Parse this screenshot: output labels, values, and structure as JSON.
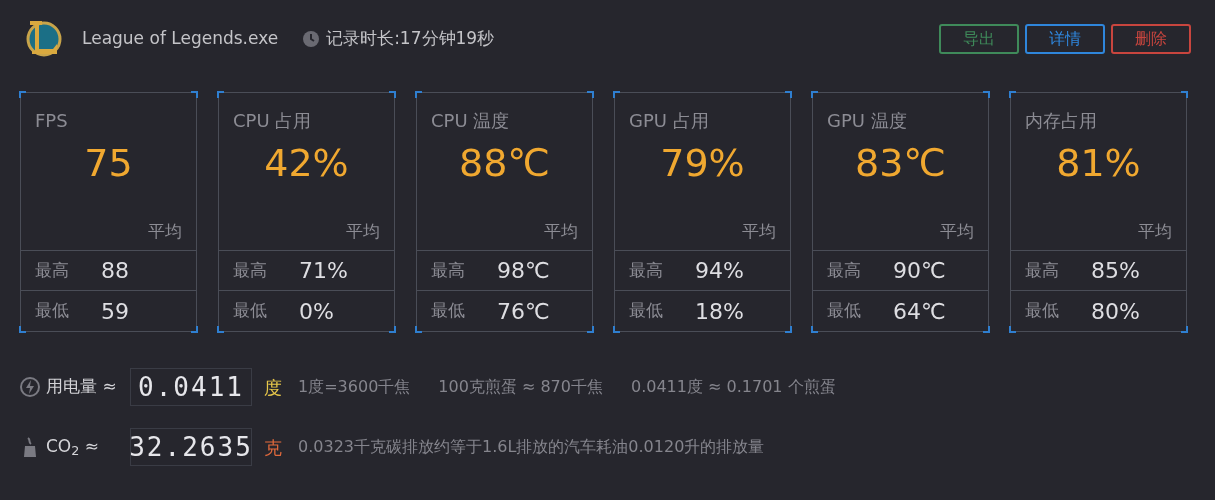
{
  "header": {
    "app_name": "League of Legends.exe",
    "duration": "记录时长:17分钟19秒"
  },
  "buttons": [
    {
      "label": "导出",
      "color": "#3f8a5a"
    },
    {
      "label": "详情",
      "color": "#2f86dc"
    },
    {
      "label": "删除",
      "color": "#c8453e"
    }
  ],
  "cards": [
    {
      "title": "FPS",
      "value": "75",
      "avg_label": "平均",
      "max_label": "最高",
      "max": "88",
      "min_label": "最低",
      "min": "59"
    },
    {
      "title": "CPU 占用",
      "value": "42%",
      "avg_label": "平均",
      "max_label": "最高",
      "max": "71%",
      "min_label": "最低",
      "min": "0%"
    },
    {
      "title": "CPU 温度",
      "value": "88℃",
      "avg_label": "平均",
      "max_label": "最高",
      "max": "98℃",
      "min_label": "最低",
      "min": "76℃"
    },
    {
      "title": "GPU 占用",
      "value": "79%",
      "avg_label": "平均",
      "max_label": "最高",
      "max": "94%",
      "min_label": "最低",
      "min": "18%"
    },
    {
      "title": "GPU 温度",
      "value": "83℃",
      "avg_label": "平均",
      "max_label": "最高",
      "max": "90℃",
      "min_label": "最低",
      "min": "64℃"
    },
    {
      "title": "内存占用",
      "value": "81%",
      "avg_label": "平均",
      "max_label": "最高",
      "max": "85%",
      "min_label": "最低",
      "min": "80%"
    }
  ],
  "stats": [
    {
      "kind": "power",
      "label": "用电量 ≈",
      "reading": "0.0411",
      "unit": "度",
      "color": "#e8c84a",
      "notes": [
        "1度=3600千焦",
        "100克煎蛋 ≈ 870千焦",
        "0.0411度 ≈ 0.1701 个煎蛋"
      ]
    },
    {
      "kind": "co2",
      "label": "CO$_{2}$ ≈",
      "reading": "32.2635",
      "unit": "克",
      "color": "#e0693c",
      "notes": [
        "0.0323千克碳排放约等于1.6L排放的汽车耗油0.0120升的排放量"
      ]
    }
  ]
}
